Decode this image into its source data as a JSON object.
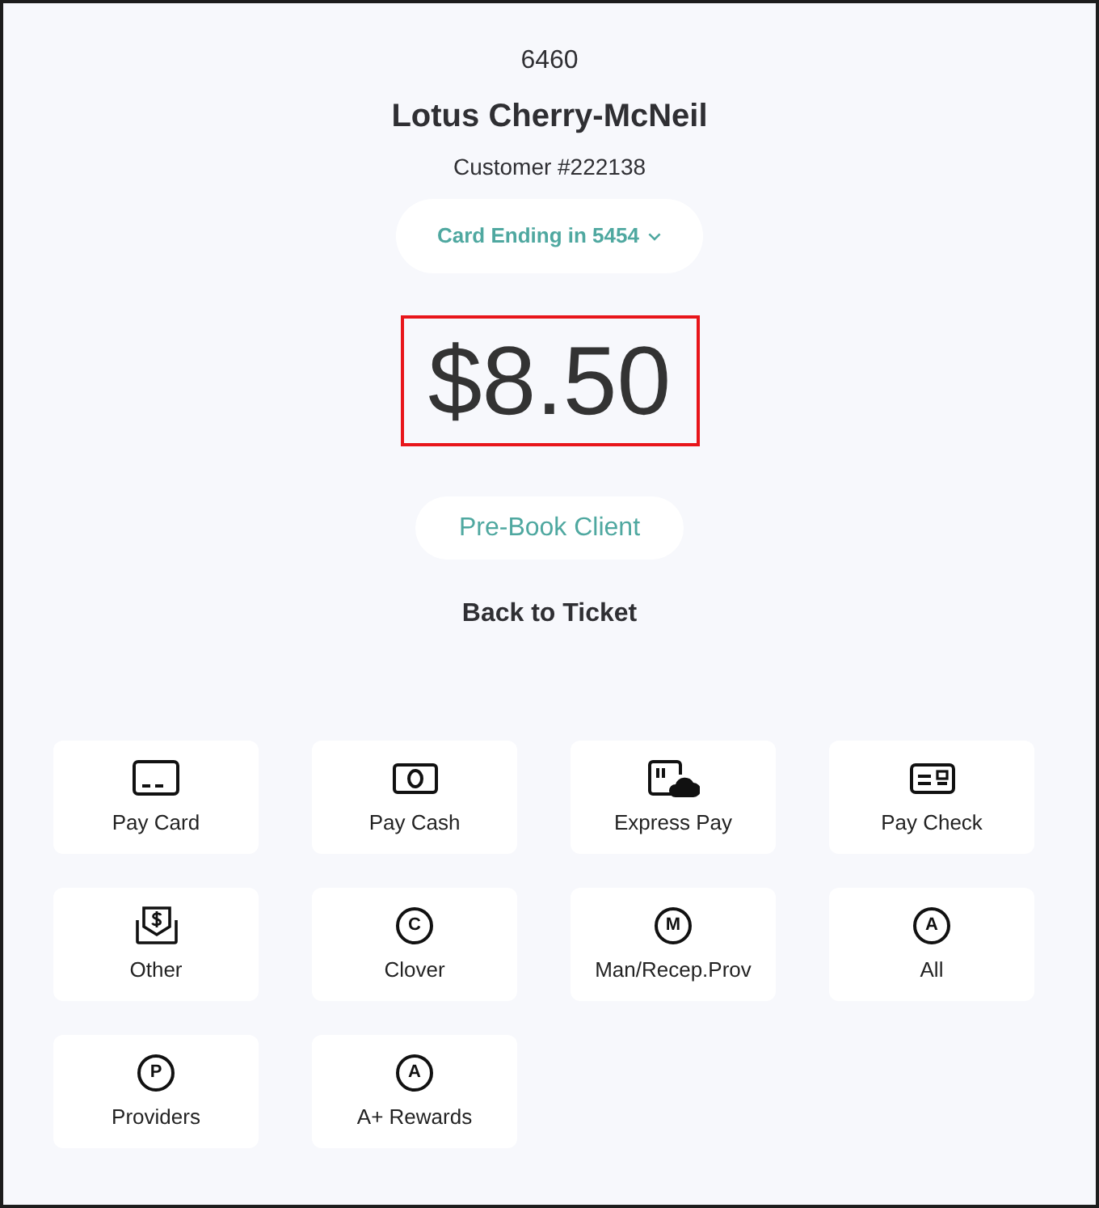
{
  "header": {
    "ticket_number": "6460",
    "client_name": "Lotus Cherry-McNeil",
    "customer_id": "Customer #222138"
  },
  "card_selector": {
    "label": "Card Ending in 5454"
  },
  "amount": {
    "text": "$8.50",
    "highlighted": true
  },
  "prebook_button": {
    "label": "Pre-Book Client"
  },
  "back_link": {
    "label": "Back to Ticket"
  },
  "payment_options": [
    {
      "kind": "card",
      "label": "Pay Card"
    },
    {
      "kind": "cash",
      "label": "Pay Cash"
    },
    {
      "kind": "express",
      "label": "Express Pay"
    },
    {
      "kind": "check",
      "label": "Pay Check"
    },
    {
      "kind": "other",
      "label": "Other"
    },
    {
      "kind": "letter",
      "letter": "C",
      "label": "Clover"
    },
    {
      "kind": "letter",
      "letter": "M",
      "label": "Man/Recep.Prov"
    },
    {
      "kind": "letter",
      "letter": "A",
      "label": "All"
    },
    {
      "kind": "letter",
      "letter": "P",
      "label": "Providers"
    },
    {
      "kind": "letter",
      "letter": "A",
      "label": "A+ Rewards"
    }
  ]
}
